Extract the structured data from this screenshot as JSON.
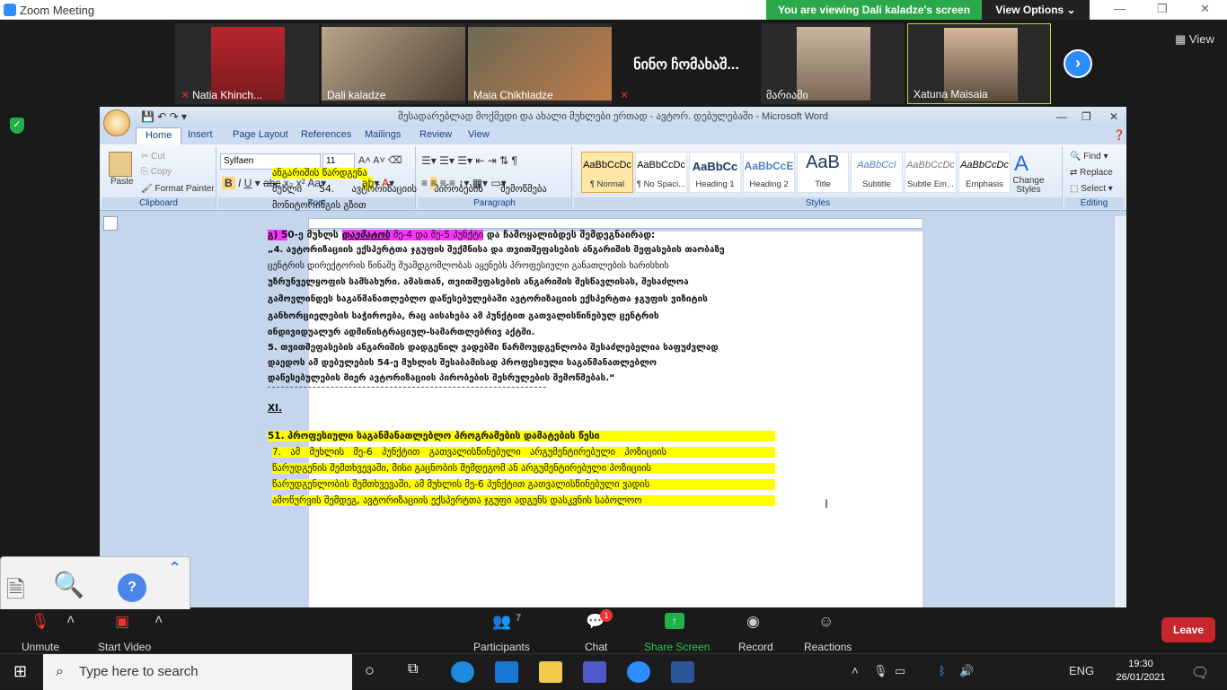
{
  "zoom": {
    "title": "Zoom Meeting",
    "banner": "You are viewing Dali kaladze's screen",
    "view_options": "View Options ⌄",
    "view_label": "View",
    "participants": [
      {
        "name": "Natia Khinch...",
        "muted": true
      },
      {
        "name": "Dali kaladze",
        "muted": false
      },
      {
        "name": "Maia Chikhladze",
        "muted": false
      },
      {
        "name": "ნინო ჩომახაშ...",
        "muted": true
      },
      {
        "name": "მარიამი",
        "muted": false
      },
      {
        "name": "Xatuna Maisaia",
        "muted": false
      }
    ],
    "toolbar": {
      "unmute": "Unmute",
      "start_video": "Start Video",
      "participants": "Participants",
      "participants_count": "7",
      "chat": "Chat",
      "chat_badge": "1",
      "share": "Share Screen",
      "record": "Record",
      "reactions": "Reactions",
      "leave": "Leave"
    }
  },
  "word": {
    "title": "შესადარებლად მოქმედი და ახალი მუხლები ერთად - ავტორ. დებულებაში - Microsoft Word",
    "tabs": [
      "Home",
      "Insert",
      "Page Layout",
      "References",
      "Mailings",
      "Review",
      "View"
    ],
    "clipboard": {
      "paste": "Paste",
      "cut": "Cut",
      "copy": "Copy",
      "format_painter": "Format Painter",
      "label": "Clipboard"
    },
    "font": {
      "name": "Sylfaen",
      "size": "11",
      "label": "Font"
    },
    "paragraph": {
      "label": "Paragraph"
    },
    "styles": {
      "items": [
        {
          "preview": "AaBbCcDc",
          "name": "¶ Normal"
        },
        {
          "preview": "AaBbCcDc",
          "name": "¶ No Spaci..."
        },
        {
          "preview": "AaBbCc",
          "name": "Heading 1"
        },
        {
          "preview": "AaBbCcE",
          "name": "Heading 2"
        },
        {
          "preview": "AaB",
          "name": "Title"
        },
        {
          "preview": "AaBbCcI",
          "name": "Subtitle"
        },
        {
          "preview": "AaBbCcDc",
          "name": "Subtle Em..."
        },
        {
          "preview": "AaBbCcDc",
          "name": "Emphasis"
        }
      ],
      "change": "Change Styles",
      "label": "Styles"
    },
    "editing": {
      "find": "Find",
      "replace": "Replace",
      "select": "Select",
      "label": "Editing"
    }
  },
  "doc": {
    "l1": "ანგარიშის წარდგენა",
    "l2": "მუხლი 54. ავტორიზაციის პირობების შემოწმება",
    "l3": "მონიტორინგის გზით",
    "l4a": "გ) 5",
    "l4b": "0-ე მუხლს ",
    "l4c": "დაემატოს",
    "l4d": " მე-4 და მე-5 პუნქტი",
    "l4e": " და ჩამოყალიბდეს შემდეგნაირად:",
    "l5": "„4. ავტორიზაციის ექსპერტთა ჯგუფის შექმნისა და თვითშეფასების ანგარიშის შეფასების თაობაზე",
    "l6": "ცენტრის დირექტორის წინაშე შუამდგომლობას აყენებს პროფესიული განათლების ხარისხის",
    "l7": "უზრუნველყოფის სამსახური. ამასთან, თვითშეფასების ანგარიშის შესწავლისას, შესაძლოა",
    "l8": "გამოვლინდეს საგანმანათლებლო დაწესებულებაში ავტორიზაციის ექსპერტთა ჯგუფის ვიზიტის",
    "l9": "განხორციელების საჭიროება, რაც აისახება ამ პუნქტით გათვალისწინებულ ცენტრის",
    "l10": "ინდივიდუალურ ადმინისტრაციულ-სამართლებრივ აქტში.",
    "l11": "5. თვითშეფასების ანგარიშის დადგენილ ვადებში წარმოუდგენლობა შესაძლებელია საფუძვლად",
    "l12": "დაედოს ამ დებულების 54-ე მუხლის შესაბამისად პროფესიული საგანმანათლებლო",
    "l13": "დაწესებულების მიერ ავტორიზაციის პირობების შესრულების შემოწმებას.“",
    "l14": "XI.",
    "l15": "51. პროფესიული საგანმანათლებლო პროგრამების დამატების წესი",
    "l16": "7. ამ მუხლის მე-6 პუნქტით გათვალისწინებული არგუმენტირებული პოზიციის",
    "l17": "წარუდგენის შემთხვევაში, მისი გაცნობის შემდეგომ ან არგუმენტირებული პოზიციის",
    "l18": "წარუდგენლობის შემთხვევაში, ამ მუხლის მე-6 პუნქტით გათვალისწინებული ვადის",
    "l19": "ამოწურვის შემდეგ, ავტორიზაციის ექსპერტთა ჯგუფი ადგენს დასკვნის საბოლოო"
  },
  "taskbar": {
    "search_placeholder": "Type here to search",
    "time": "19:30",
    "date": "26/01/2021",
    "lang": "ENG"
  }
}
